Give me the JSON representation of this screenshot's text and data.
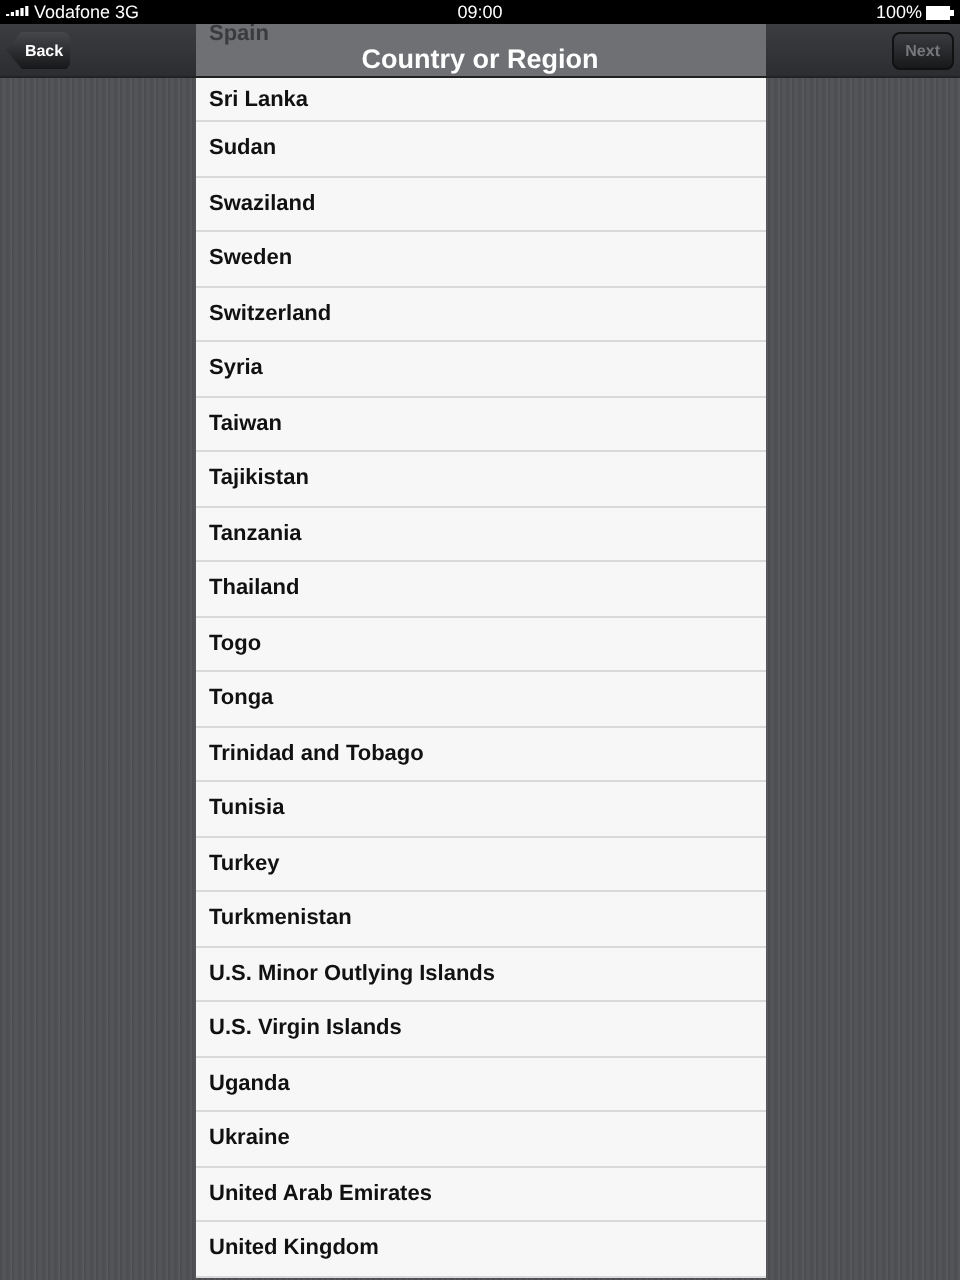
{
  "status_bar": {
    "carrier": "Vodafone 3G",
    "time": "09:00",
    "battery": "100%"
  },
  "nav_bar": {
    "title": "Country or Region",
    "back": "Back",
    "next": {
      "label": "Next",
      "disabled": true
    }
  },
  "countries": [
    "Spain",
    "Sri Lanka",
    "Sudan",
    "Swaziland",
    "Sweden",
    "Switzerland",
    "Syria",
    "Taiwan",
    "Tajikistan",
    "Tanzania",
    "Thailand",
    "Togo",
    "Tonga",
    "Trinidad and Tobago",
    "Tunisia",
    "Turkey",
    "Turkmenistan",
    "U.S. Minor Outlying Islands",
    "U.S. Virgin Islands",
    "Uganda",
    "Ukraine",
    "United Arab Emirates",
    "United Kingdom"
  ]
}
